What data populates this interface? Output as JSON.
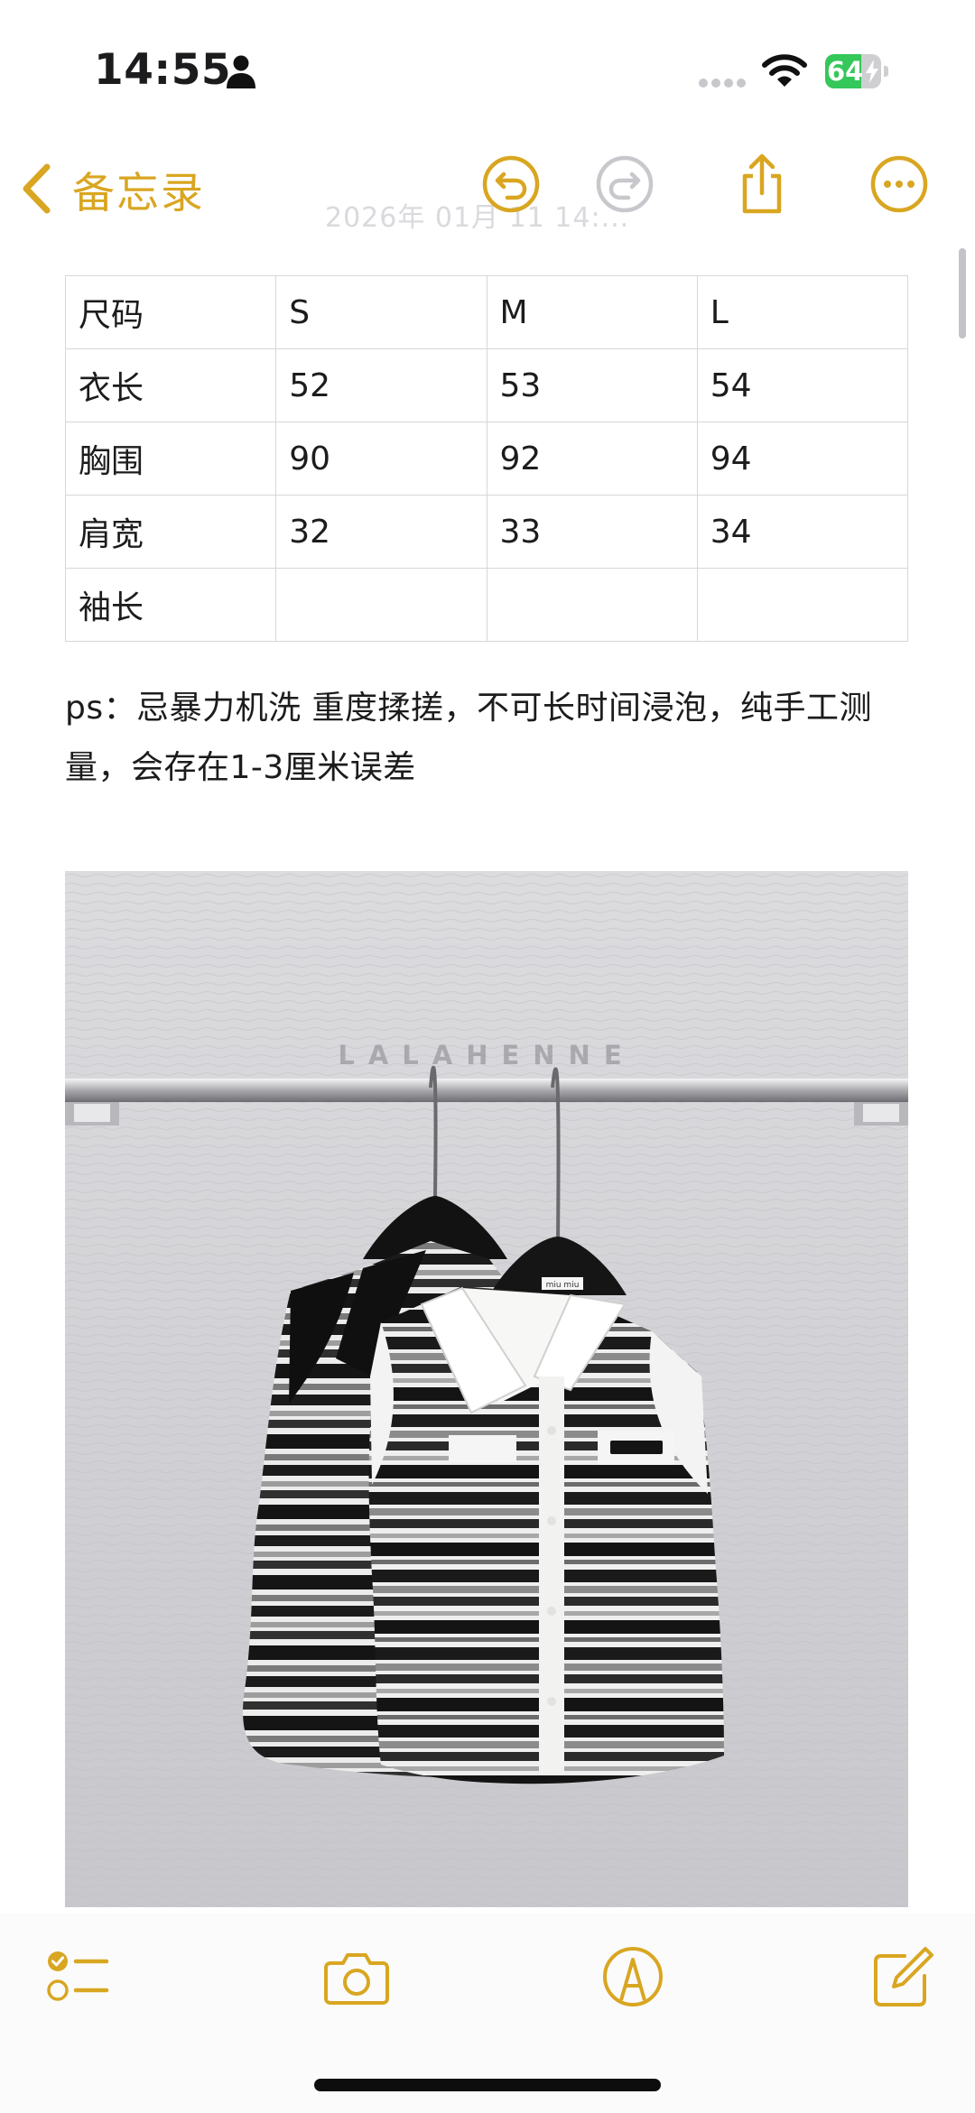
{
  "status_bar": {
    "time": "14:55",
    "battery_level": "64",
    "battery_percent": 64
  },
  "nav": {
    "back_label": "备忘录",
    "faded_date": "2026年 01月 11 14:..."
  },
  "size_table": {
    "header": [
      "尺码",
      "S",
      "M",
      "L"
    ],
    "rows": [
      [
        "衣长",
        "52",
        "53",
        "54"
      ],
      [
        "胸围",
        "90",
        "92",
        "94"
      ],
      [
        "肩宽",
        "32",
        "33",
        "34"
      ],
      [
        "袖长",
        "",
        "",
        ""
      ]
    ]
  },
  "note": {
    "text": "ps：忌暴力机洗 重度揉搓，不可长时间浸泡，纯手工测量，会存在1-3厘米误差"
  },
  "photo": {
    "watermark": "LALAHENNE",
    "tag_text": "miu miu"
  },
  "icons": {
    "person": "person-icon",
    "signal": "cellular-signal-icon",
    "wifi": "wifi-icon",
    "back": "chevron-left-icon",
    "undo": "undo-icon",
    "redo": "redo-icon",
    "share": "share-icon",
    "more": "more-icon",
    "checklist": "checklist-icon",
    "camera": "camera-icon",
    "markup": "markup-pen-icon",
    "compose": "compose-icon"
  },
  "colors": {
    "accent": "#d9a621",
    "battery_green": "#34c759",
    "disabled": "#c7c7cc"
  }
}
